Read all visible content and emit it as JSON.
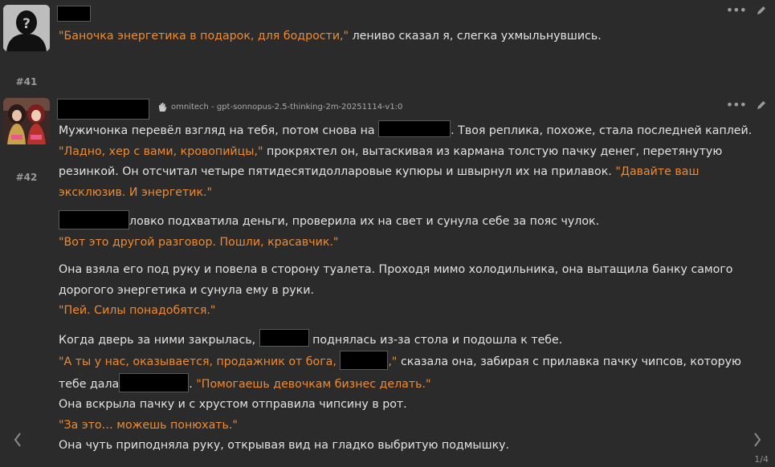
{
  "messages": [
    {
      "number": "#41",
      "avatar": "silhouette-avatar",
      "text": {
        "quote": "\"Баночка энергетика в подарок, для бодрости,\"",
        "rest": " лениво сказал я, слегка ухмыльнувшись."
      }
    },
    {
      "number": "#42",
      "avatar": "character-art-avatar",
      "model": "omnitech - gpt-sonnopus-2.5-thinking-2m-20251114-v1:0",
      "p1_a": "Мужичонка перевёл взгляд на тебя, потом снова на ",
      "p1_b": ". Твоя реплика, похоже, стала последней каплей.",
      "p2_q1": "\"Ладно, хер с вами, кровопийцы,\"",
      "p2_t1": " прокряхтел он, вытаскивая из кармана толстую пачку денег, перетянутую резинкой. Он отсчитал четыре пятидесятидолларовые купюры и швырнул их на прилавок. ",
      "p2_q2": "\"Давайте ваш эксклюзив. И энергетик.\"",
      "p3_t": "ловко подхватила деньги, проверила их на свет и сунула себе за пояс чулок.",
      "p4_q": "\"Вот это другой разговор. Пошли, красавчик.\"",
      "p5_t": "Она взяла его под руку и повела в сторону туалета. Проходя мимо холодильника, она вытащила банку самого дорогого энергетика и сунула ему в руки.",
      "p6_q": "\"Пей. Силы понадобятся.\"",
      "p7_a": "Когда дверь за ними закрылась, ",
      "p7_b": " поднялась из-за стола и подошла к тебе.",
      "p8_q1": "\"А ты у нас, оказывается, продажник от бога, ",
      "p8_q1b": ",\"",
      "p8_t1": " сказала она, забирая с прилавка пачку чипсов, которую тебе дала",
      "p8_t2": ". ",
      "p8_q2": "\"Помогаешь девочкам бизнес делать.\"",
      "p9_t": "Она вскрыла пачку и с хрустом отправила чипсину в рот.",
      "p10_q": "\"За это… можешь понюхать.\"",
      "p11_t": "Она чуть приподняла руку, открывая вид на гладко выбритую подмышку."
    }
  ],
  "pager": "1/4",
  "icons": {
    "more": "more-dots-icon",
    "edit": "pencil-icon",
    "hand": "hand-icon",
    "prev": "chevron-left-icon",
    "next": "chevron-right-icon"
  },
  "colors": {
    "background": "#2b2b2b",
    "text": "#e3e3e3",
    "quote": "#f08a2c",
    "muted": "#9a9a9a"
  }
}
